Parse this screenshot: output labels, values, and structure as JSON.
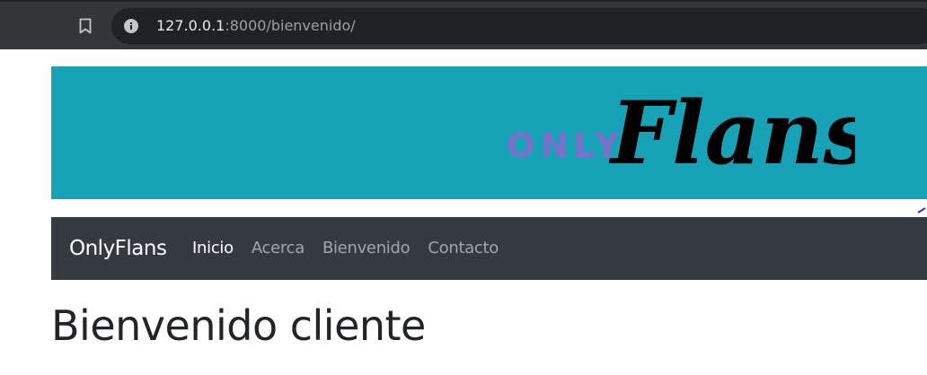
{
  "browser": {
    "url_host": "127.0.0.1",
    "url_rest": ":8000/bienvenido/",
    "icons": {
      "bookmark": "bookmark-icon",
      "site_info": "info-icon"
    }
  },
  "banner": {
    "background": "#17a2b8",
    "logo": {
      "small_text": "ONLY",
      "script_text": "Flans",
      "small_color": "#7a6fc9",
      "script_color": "#000000"
    }
  },
  "navbar": {
    "background": "#343a40",
    "brand": "OnlyFlans",
    "links": [
      {
        "label": "Inicio",
        "active": true
      },
      {
        "label": "Acerca",
        "active": false
      },
      {
        "label": "Bienvenido",
        "active": false
      },
      {
        "label": "Contacto",
        "active": false
      }
    ]
  },
  "main": {
    "heading": "Bienvenido cliente"
  }
}
